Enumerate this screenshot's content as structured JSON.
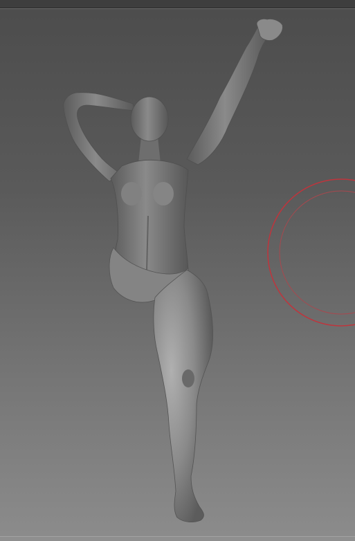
{
  "viewport": {
    "model_icon": "female-figure-mannequin-icon",
    "brush_cursor_icon": "brush-cursor-icon"
  },
  "colors": {
    "bg_top": "#4c4c4c",
    "bg_bottom": "#8c8c8c",
    "model": "#7b7b7b",
    "brush_ring": "#c0343c"
  }
}
